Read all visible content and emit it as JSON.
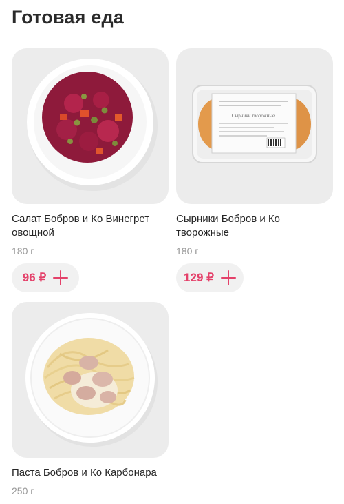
{
  "section": {
    "title": "Готовая еда"
  },
  "products": [
    {
      "name": "Салат Бобров и Ко Винегрет овощной",
      "weight": "180 г",
      "price": "96 ₽",
      "image_icon": "vinaigrette-salad-image"
    },
    {
      "name": "Сырники Бобров и Ко творожные",
      "weight": "180 г",
      "price": "129 ₽",
      "image_icon": "syrniki-package-image",
      "package_label": "Сырники творожные"
    },
    {
      "name": "Паста Бобров и Ко Карбонара",
      "weight": "250 г",
      "image_icon": "carbonara-pasta-image"
    }
  ],
  "colors": {
    "accent": "#e4416a",
    "card_bg": "#ececec",
    "button_bg": "#f1f1f1"
  }
}
